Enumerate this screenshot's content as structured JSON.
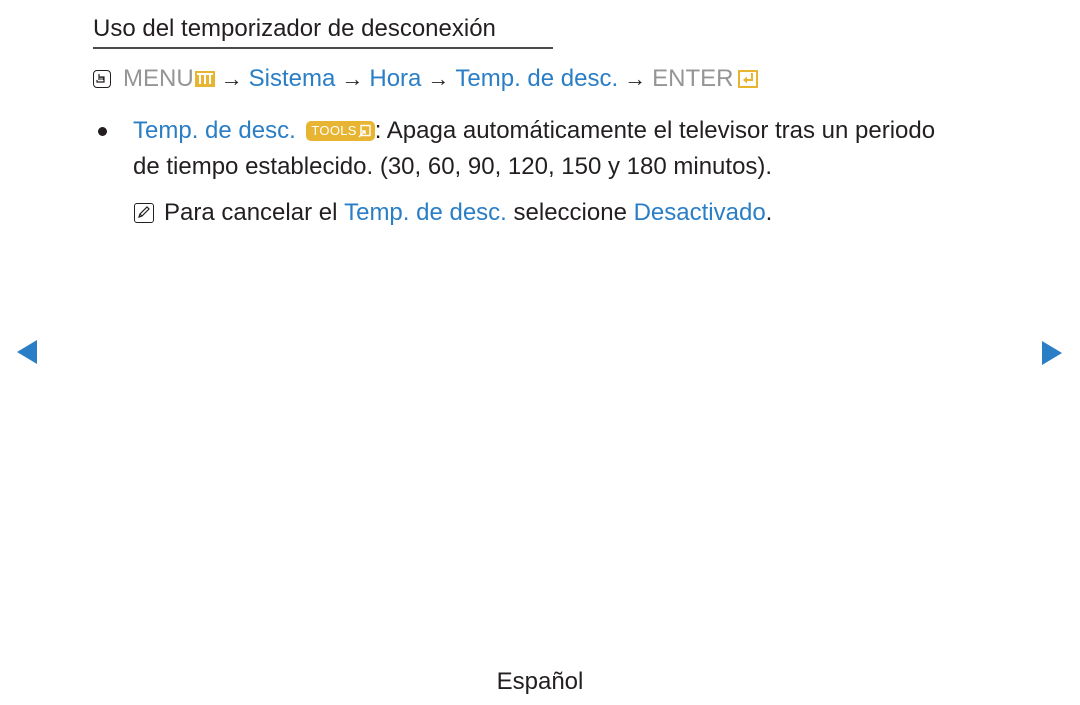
{
  "page": {
    "heading": "Uso del temporizador de desconexión",
    "path": {
      "menu_label": "MENU",
      "steps": [
        "Sistema",
        "Hora",
        "Temp. de desc."
      ],
      "enter_label": "ENTER",
      "arrow": "→"
    },
    "bullet": {
      "term": "Temp. de desc.",
      "tools_label": "TOOLS",
      "description_line1": ": Apaga automáticamente el televisor tras un periodo",
      "description_line2": "de tiempo establecido. (30, 60, 90, 120, 150 y 180 minutos)."
    },
    "note": {
      "prefix": "Para cancelar el ",
      "term": "Temp. de desc.",
      "middle": " seleccione ",
      "option": "Desactivado",
      "suffix": "."
    },
    "navigation": {
      "prev_icon": "triangle-left",
      "next_icon": "triangle-right"
    },
    "footer": {
      "language": "Español"
    },
    "colors": {
      "accent_blue": "#2a7ec6",
      "button_yellow": "#e7b531",
      "menu_grey": "#959595",
      "text": "#231f20"
    }
  }
}
